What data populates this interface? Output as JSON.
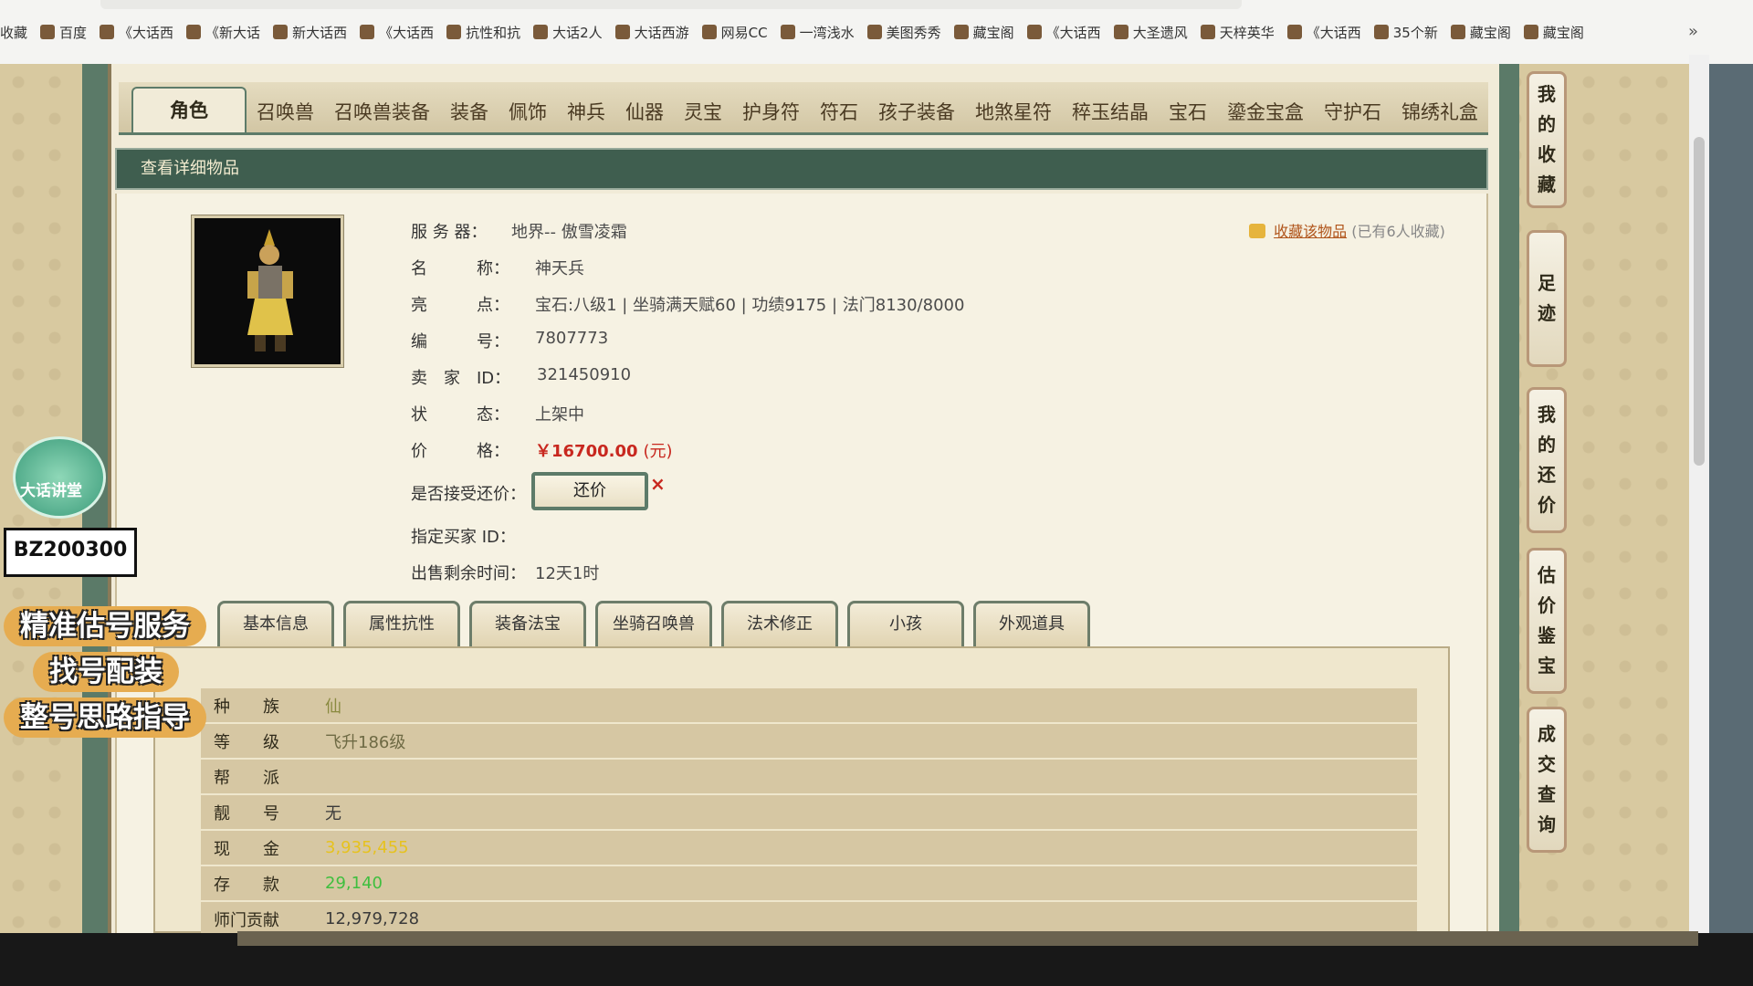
{
  "bookmarks": {
    "items": [
      "收藏",
      "百度",
      "《大话西",
      "《新大话",
      "新大话西",
      "《大话西",
      "抗性和抗",
      "大话2人",
      "大话西游",
      "网易CC",
      "一湾浅水",
      "美图秀秀",
      "藏宝阁",
      "《大话西",
      "大圣遗风",
      "天梓英华",
      "《大话西",
      "35个新",
      "藏宝阁",
      "藏宝阁"
    ],
    "more": "»"
  },
  "tabs": [
    "角色",
    "召唤兽",
    "召唤兽装备",
    "装备",
    "佩饰",
    "神兵",
    "仙器",
    "灵宝",
    "护身符",
    "符石",
    "孩子装备",
    "地煞星符",
    "稡玉结晶",
    "宝石",
    "鎏金宝盒",
    "守护石",
    "锦绣礼盒"
  ],
  "section_title": "查看详细物品",
  "favorite": {
    "link": "收藏该物品",
    "count": "(已有6人收藏)"
  },
  "details": {
    "server": {
      "label": "服 务 器：",
      "value": "地界-- 傲雪凌霜"
    },
    "name": {
      "label": "名　　　称：",
      "value": "神天兵"
    },
    "highlights": {
      "label": "亮　　　点：",
      "value": "宝石:八级1 | 坐骑满天赋60 | 功绩9175 | 法门8130/8000"
    },
    "number": {
      "label": "编　　　号：",
      "value": "7807773"
    },
    "seller": {
      "label": "卖　家　ID：",
      "value": "321450910"
    },
    "status": {
      "label": "状　　　态：",
      "value": "上架中"
    },
    "price": {
      "label": "价　　　格：",
      "value": "￥16700.00",
      "unit": "(元)"
    },
    "counter_offer": {
      "label": "是否接受还价：",
      "button": "还价",
      "mark": "×"
    },
    "buyer_id": {
      "label": "指定买家 ID：",
      "value": ""
    },
    "remaining": {
      "label": "出售剩余时间：",
      "value": "12天1时"
    }
  },
  "subtabs": [
    "基本信息",
    "属性抗性",
    "装备法宝",
    "坐骑召唤兽",
    "法术修正",
    "小孩",
    "外观道具"
  ],
  "attributes": [
    {
      "key": "种　　族",
      "value": "仙"
    },
    {
      "key": "等　　级",
      "value": "飞升186级"
    },
    {
      "key": "帮　　派",
      "value": ""
    },
    {
      "key": "靓　　号",
      "value": "无"
    },
    {
      "key": "现　　金",
      "value": "3,935,455"
    },
    {
      "key": "存　　款",
      "value": "29,140"
    },
    {
      "key": "师门贡献",
      "value": "12,979,728"
    }
  ],
  "sidebar": [
    [
      "我",
      "的",
      "收",
      "藏"
    ],
    [
      "足",
      "迹"
    ],
    [
      "我",
      "的",
      "还",
      "价"
    ],
    [
      "估",
      "价",
      "鉴",
      "宝"
    ],
    [
      "成",
      "交",
      "查",
      "询"
    ]
  ],
  "overlay": {
    "badge": "大话讲堂",
    "streamer_id": "BZ200300",
    "promo": [
      "精准估号服务",
      "找号配装",
      "整号思路指导"
    ]
  },
  "colors": {
    "accent_green": "#3f5e4f",
    "price_red": "#c8281f",
    "cash_gold": "#e6c21e",
    "deposit_green": "#3fbf3f"
  }
}
